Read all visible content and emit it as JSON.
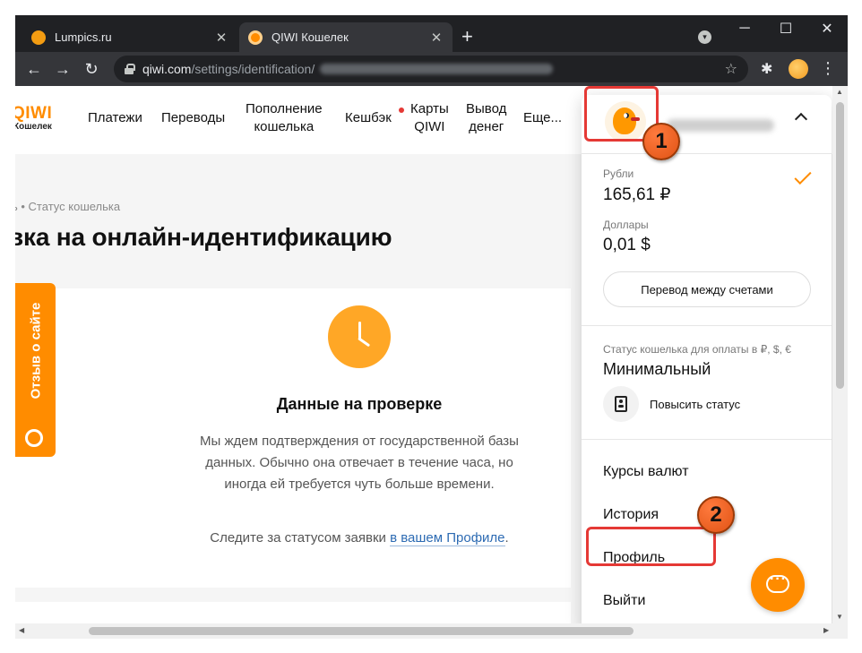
{
  "browser": {
    "tabs": [
      {
        "title": "Lumpics.ru",
        "favicon_color": "#f39c12",
        "close": "✕"
      },
      {
        "title": "QIWI Кошелек",
        "favicon_color": "#ff8c00",
        "close": "✕"
      }
    ],
    "new_tab": "+",
    "window_buttons": {
      "minimize": "─",
      "maximize": "☐",
      "close": "✕"
    },
    "nav": {
      "back": "←",
      "forward": "→",
      "reload": "↻"
    },
    "url_host": "qiwi.com",
    "url_path": "/settings/identification/",
    "star": "☆",
    "extensions": "✱",
    "menu": "⋮"
  },
  "site": {
    "logo": "QIWI",
    "logo_sub": "Кошелек",
    "nav": [
      "Платежи",
      "Переводы",
      "Пополнение кошелька",
      "Кешбэк",
      "Карты QIWI",
      "Вывод денег",
      "Еще..."
    ],
    "nav_html": {
      "topup_1": "Пополнение",
      "topup_2": "кошелька",
      "cards_1": "Карты",
      "cards_2": "QIWI",
      "withdraw_1": "Вывод",
      "withdraw_2": "денег"
    },
    "breadcrumb": "ь  •  Статус кошелька",
    "page_title": "вка на онлайн-идентификацию",
    "card": {
      "title": "Данные на проверке",
      "text": "Мы ждем подтверждения от государственной базы данных. Обычно она отвечает в течение часа, но иногда ей требуется чуть больше времени.",
      "foot_text": "Следите за статусом заявки ",
      "foot_link": "в вашем Профиле",
      "foot_end": "."
    },
    "feedback_label": "Отзыв о сайте"
  },
  "panel": {
    "rub_label": "Рубли",
    "rub_value": "165,61 ₽",
    "usd_label": "Доллары",
    "usd_value": "0,01 $",
    "transfer_button": "Перевод между счетами",
    "status_note": "Статус кошелька для оплаты в ₽, $, €",
    "status_value": "Минимальный",
    "raise_status": "Повысить статус",
    "menu": [
      "Курсы валют",
      "История",
      "Профиль",
      "Выйти"
    ]
  },
  "annotations": {
    "step1": "1",
    "step2": "2",
    "color": "#e53935"
  },
  "colors": {
    "brand": "#ff8c00",
    "link": "#2d6bb3"
  }
}
